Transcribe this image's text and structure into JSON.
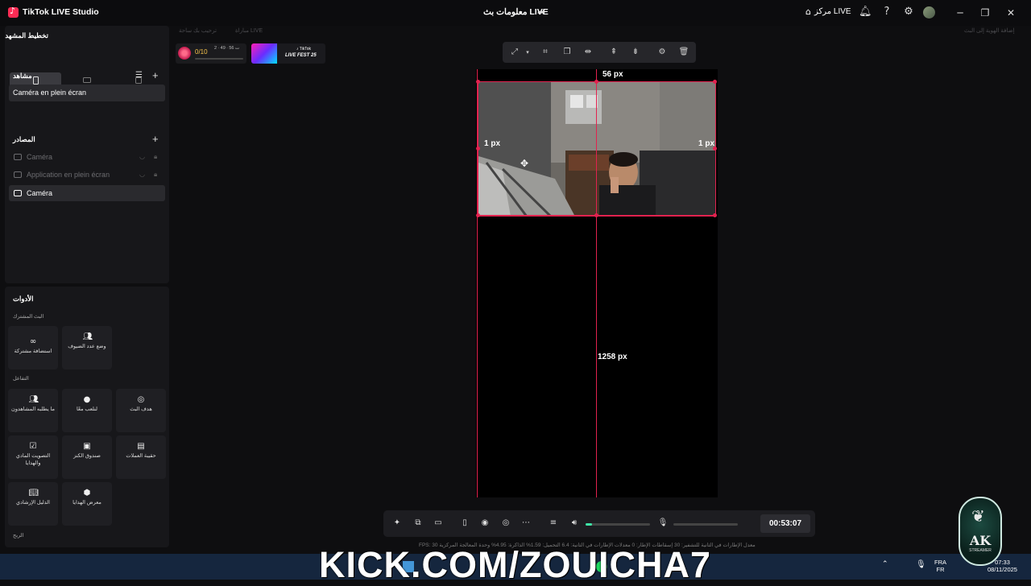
{
  "titlebar": {
    "app_title": "TikTok LIVE Studio",
    "stream_info": "معلومات بث LIVE",
    "live_center": "مركز LIVE",
    "icons": [
      "home-icon",
      "bell-icon",
      "help-icon",
      "settings-icon"
    ]
  },
  "left_panel": {
    "layout_title": "تخطيط المشهد",
    "scenes_title": "مشاهد",
    "scene_item": "Caméra en plein écran",
    "sources_title": "المصادر",
    "sources": [
      {
        "label": "Caméra",
        "active": false
      },
      {
        "label": "Application en plein écran",
        "active": false
      },
      {
        "label": "Caméra",
        "active": true
      }
    ],
    "tools_title": "الأدوات",
    "section_cohost": "البث المشترك",
    "section_interaction": "التفاعل",
    "section_earnings": "الربح",
    "tools_cohost": [
      "استضافة مشتركة",
      "وضع عدد الضيوف"
    ],
    "tools_interaction": [
      "ما يطلبه المشاهدون",
      "لنلعب معًا",
      "هدف البث",
      "التصويت المادي والهدايا",
      "صندوق الكنز",
      "حقيبة العملات",
      "الدليل الإرشادي",
      "معرض الهدايا"
    ]
  },
  "widgets": {
    "faded_1": "ترحيب بك ساحة",
    "faded_2": "مباراة LIVE",
    "goal_count": "0/10",
    "goal_time": "ت 56 ∙ 49 ∙ 2",
    "livefest_brand": "♪ TikTok",
    "livefest_text": "LIVE FEST 25",
    "faded_right": "إضافة الهوية إلى البث"
  },
  "canvas": {
    "label_top": "56 px",
    "label_left": "1 px",
    "label_right": "1 px",
    "label_bottom": "1258 px"
  },
  "controls": {
    "timer": "00:53:07",
    "volume_level": 0.1,
    "stats": "FPS:  30     معدل الإطارات في الثانية للتشفير: 30     إسقاطات الإطار: 0     معدلات الإطارات في الثانية: 6.4     التحميل: 1.59%     الذاكرة: 4.95%     وحدة المعالجة المركزية"
  },
  "overlay": {
    "kick_text": "KICK.COM/ZOUICHA7",
    "ak_text": "AK",
    "ak_sub": "STREAMER"
  },
  "taskbar": {
    "lang_top": "FRA",
    "lang_bottom": "FR",
    "time": "07:33",
    "date": "08/11/2025"
  }
}
